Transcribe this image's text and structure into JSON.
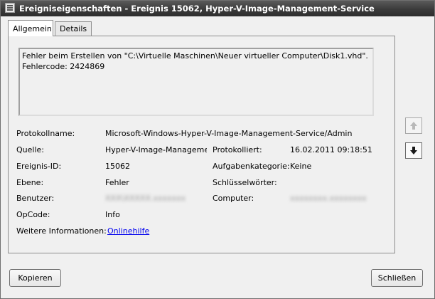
{
  "window": {
    "title": "Ereigniseigenschaften - Ereignis 15062, Hyper-V-Image-Management-Service"
  },
  "tabs": [
    {
      "label": "Allgemein",
      "active": true
    },
    {
      "label": "Details",
      "active": false
    }
  ],
  "general": {
    "description_line1": "Fehler beim Erstellen von \"C:\\Virtuelle Maschinen\\Neuer virtueller Computer\\Disk1.vhd\".",
    "description_line2": "Fehlercode: 2424869",
    "fields": {
      "protokollname_label": "Protokollname:",
      "protokollname_value": "Microsoft-Windows-Hyper-V-Image-Management-Service/Admin",
      "quelle_label": "Quelle:",
      "quelle_value": "Hyper-V-Image-Managemer",
      "protokolliert_label": "Protokolliert:",
      "protokolliert_value": "16.02.2011 09:18:51",
      "ereignis_id_label": "Ereignis-ID:",
      "ereignis_id_value": "15062",
      "aufgabenkategorie_label": "Aufgabenkategorie:",
      "aufgabenkategorie_value": "Keine",
      "ebene_label": "Ebene:",
      "ebene_value": "Fehler",
      "schluesselwoerter_label": "Schlüsselwörter:",
      "benutzer_label": "Benutzer:",
      "computer_label": "Computer:",
      "opcode_label": "OpCode:",
      "opcode_value": "Info",
      "weitere_label": "Weitere Informationen:",
      "weitere_link": "Onlinehilfe"
    }
  },
  "buttons": {
    "copy": "Kopieren",
    "close": "Schließen"
  },
  "icons": {
    "app": "event-viewer-icon",
    "up": "arrow-up-icon",
    "down": "arrow-down-icon"
  }
}
